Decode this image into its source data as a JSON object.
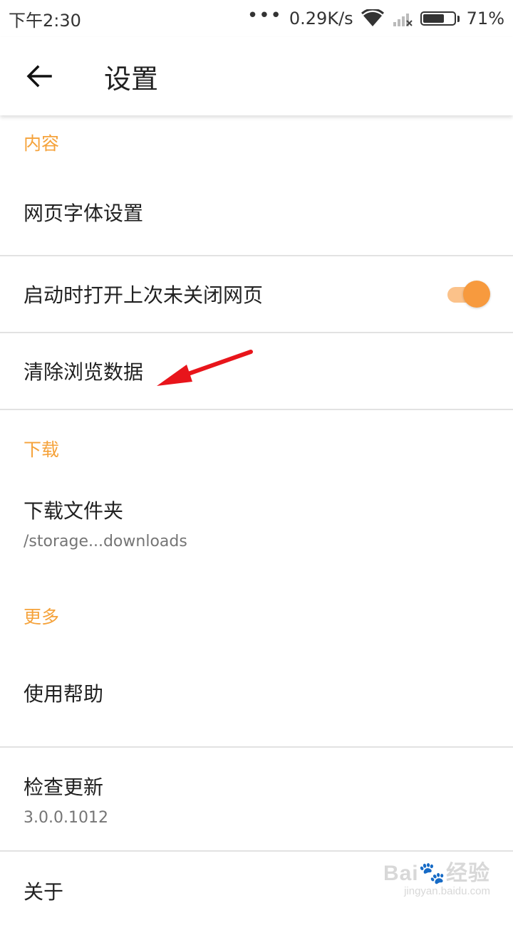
{
  "status_bar": {
    "time": "下午2:30",
    "dots": "•••",
    "speed": "0.29K/s",
    "battery": "71%",
    "battery_level": 0.71
  },
  "appbar": {
    "title": "设置",
    "back_icon": "arrow-left-icon"
  },
  "sections": {
    "content": {
      "header": "内容",
      "font_settings": "网页字体设置",
      "restore_tabs": "启动时打开上次未关闭网页",
      "restore_tabs_enabled": true,
      "clear_data": "清除浏览数据"
    },
    "download": {
      "header": "下载",
      "folder_label": "下载文件夹",
      "folder_path": "/storage...downloads"
    },
    "more": {
      "header": "更多",
      "help": "使用帮助",
      "check_update": "检查更新",
      "version": "3.0.0.1012",
      "about": "关于"
    }
  },
  "annotation": {
    "arrow_color": "#e8151b"
  },
  "accent_color": "#f5a23a",
  "watermark": {
    "top": "Bai🐾经验",
    "bottom": "jingyan.baidu.com"
  }
}
